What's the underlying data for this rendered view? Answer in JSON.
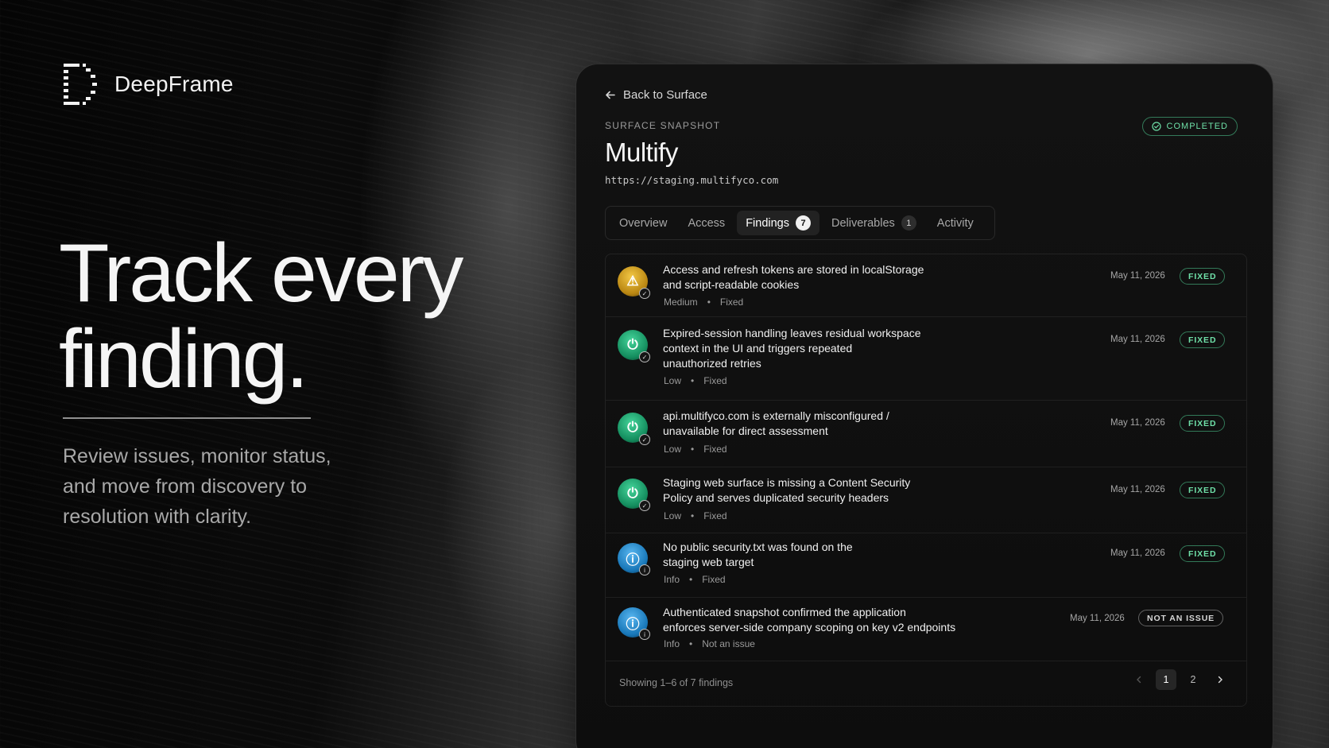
{
  "brand": {
    "name": "DeepFrame"
  },
  "hero": {
    "headline_line1": "Track every",
    "headline_line2": "finding.",
    "subcopy_line1": "Review issues, monitor status,",
    "subcopy_line2": "and move from discovery to",
    "subcopy_line3": "resolution with clarity."
  },
  "panel": {
    "back_label": "Back to Surface",
    "eyebrow": "SURFACE SNAPSHOT",
    "status": "COMPLETED",
    "title": "Multify",
    "url": "https://staging.multifyco.com",
    "tabs": [
      {
        "label": "Overview"
      },
      {
        "label": "Access"
      },
      {
        "label": "Findings",
        "count": "7"
      },
      {
        "label": "Deliverables",
        "count": "1"
      },
      {
        "label": "Activity"
      }
    ],
    "findings": [
      {
        "title_line1": "Access and refresh tokens are stored in localStorage",
        "title_line2": "and script-readable cookies",
        "severity": "Medium",
        "state": "Fixed",
        "date": "May 11, 2026",
        "badge": "FIXED",
        "icon": "warning-icon"
      },
      {
        "title_line1": "Expired-session handling leaves residual workspace",
        "title_line2": "context in the UI and triggers repeated",
        "title_line3": "unauthorized retries",
        "severity": "Low",
        "state": "Fixed",
        "date": "May 11, 2026",
        "badge": "FIXED",
        "icon": "lock-icon"
      },
      {
        "title_line1": "api.multifyco.com is externally misconfigured /",
        "title_line2": "unavailable for direct assessment",
        "severity": "Low",
        "state": "Fixed",
        "date": "May 11, 2026",
        "badge": "FIXED",
        "icon": "lock-icon"
      },
      {
        "title_line1": "Staging web surface is missing a Content Security",
        "title_line2": "Policy and serves duplicated security headers",
        "severity": "Low",
        "state": "Fixed",
        "date": "May 11, 2026",
        "badge": "FIXED",
        "icon": "lock-icon"
      },
      {
        "title_line1": "No public security.txt was found on the",
        "title_line2": "staging web target",
        "severity": "Info",
        "state": "Fixed",
        "date": "May 11, 2026",
        "badge": "FIXED",
        "icon": "info-icon"
      },
      {
        "title_line1": "Authenticated snapshot confirmed the application",
        "title_line2": "enforces server-side company scoping on key v2 endpoints",
        "severity": "Info",
        "state": "Not an issue",
        "date": "May 11, 2026",
        "badge": "NOT AN ISSUE",
        "icon": "info-icon"
      }
    ],
    "footer_text": "Showing 1–6 of 7 findings",
    "pages": [
      "1",
      "2"
    ]
  },
  "colors": {
    "accent_green": "#6fe0a8",
    "severity_medium": "#e0b030",
    "severity_low": "#2fbf83",
    "severity_info": "#3a9ee0"
  }
}
